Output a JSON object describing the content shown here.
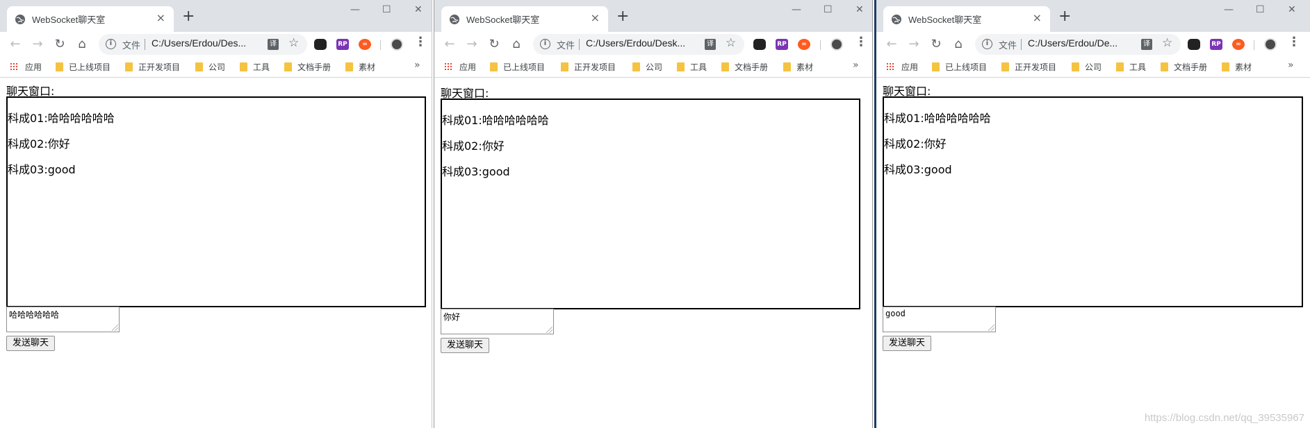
{
  "windows": [
    {
      "tab_title": "WebSocket聊天室",
      "omnibox": {
        "file_label": "文件",
        "url": "C:/Users/Erdou/Des..."
      },
      "bookmarks": [
        "应用",
        "已上线项目",
        "正开发项目",
        "公司",
        "工具",
        "文档手册",
        "素材"
      ],
      "chat_label": "聊天窗口:",
      "messages": [
        "科成01:哈哈哈哈哈哈",
        "科成02:你好",
        "科成03:good"
      ],
      "input_value": "哈哈哈哈哈哈",
      "send_label": "发送聊天"
    },
    {
      "tab_title": "WebSocket聊天室",
      "omnibox": {
        "file_label": "文件",
        "url": "C:/Users/Erdou/Desk..."
      },
      "bookmarks": [
        "应用",
        "已上线项目",
        "正开发项目",
        "公司",
        "工具",
        "文档手册",
        "素材"
      ],
      "chat_label": "聊天窗口:",
      "messages": [
        "科成01:哈哈哈哈哈哈",
        "科成02:你好",
        "科成03:good"
      ],
      "input_value": "你好",
      "send_label": "发送聊天"
    },
    {
      "tab_title": "WebSocket聊天室",
      "omnibox": {
        "file_label": "文件",
        "url": "C:/Users/Erdou/De..."
      },
      "bookmarks": [
        "应用",
        "已上线项目",
        "正开发项目",
        "公司",
        "工具",
        "文档手册",
        "素材"
      ],
      "chat_label": "聊天窗口:",
      "messages": [
        "科成01:哈哈哈哈哈哈",
        "科成02:你好",
        "科成03:good"
      ],
      "input_value": "good",
      "send_label": "发送聊天"
    }
  ],
  "icons": {
    "close": "×",
    "new_tab": "+",
    "minimize": "—",
    "maximize": "☐",
    "window_close": "✕",
    "back": "←",
    "forward": "→",
    "reload": "↻",
    "home": "⌂",
    "info": "i",
    "translate": "译",
    "star": "☆",
    "ext_rp": "RP",
    "ext_infinity": "∞",
    "menu": "⋮",
    "more": "»"
  },
  "colors": {
    "ext_rp": "#7c34b5",
    "ext_infinity": "#ff5a1f",
    "folder": "#f5c342"
  },
  "watermark": "https://blog.csdn.net/qq_39535967"
}
